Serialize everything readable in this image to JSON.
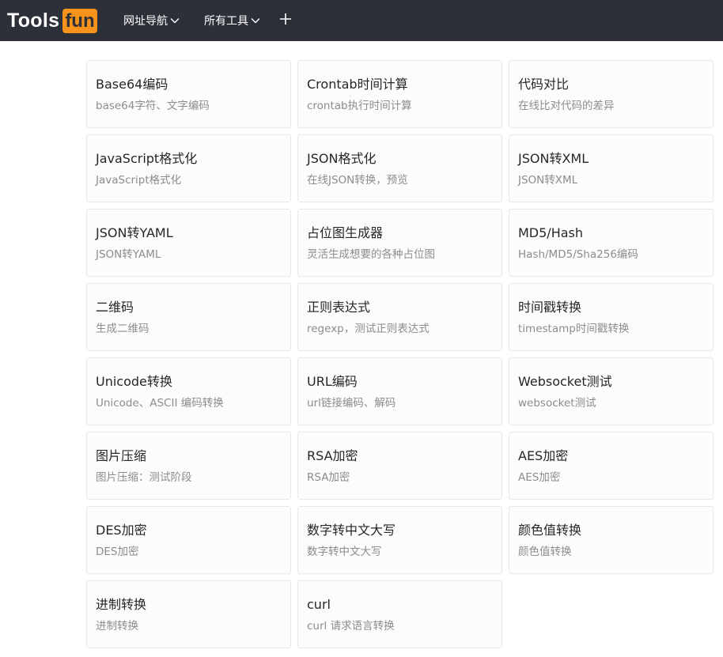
{
  "header": {
    "logo_text": "Tools",
    "logo_badge": "fun",
    "nav": [
      {
        "label": "网址导航",
        "icon": "chevron-down-icon"
      },
      {
        "label": "所有工具",
        "icon": "chevron-down-icon"
      }
    ],
    "add_icon": "plus-icon"
  },
  "tools": [
    {
      "title": "Base64编码",
      "desc": "base64字符、文字编码"
    },
    {
      "title": "Crontab时间计算",
      "desc": "crontab执行时间计算"
    },
    {
      "title": "代码对比",
      "desc": "在线比对代码的差异"
    },
    {
      "title": "JavaScript格式化",
      "desc": "JavaScript格式化"
    },
    {
      "title": "JSON格式化",
      "desc": "在线JSON转换，预览"
    },
    {
      "title": "JSON转XML",
      "desc": "JSON转XML"
    },
    {
      "title": "JSON转YAML",
      "desc": "JSON转YAML"
    },
    {
      "title": "占位图生成器",
      "desc": "灵活生成想要的各种占位图"
    },
    {
      "title": "MD5/Hash",
      "desc": "Hash/MD5/Sha256编码"
    },
    {
      "title": "二维码",
      "desc": "生成二维码"
    },
    {
      "title": "正则表达式",
      "desc": "regexp，测试正则表达式"
    },
    {
      "title": "时间戳转换",
      "desc": "timestamp时间戳转换"
    },
    {
      "title": "Unicode转换",
      "desc": "Unicode、ASCII 编码转换"
    },
    {
      "title": "URL编码",
      "desc": "url链接编码、解码"
    },
    {
      "title": "Websocket测试",
      "desc": "websocket测试"
    },
    {
      "title": "图片压缩",
      "desc": "图片压缩：测试阶段"
    },
    {
      "title": "RSA加密",
      "desc": "RSA加密"
    },
    {
      "title": "AES加密",
      "desc": "AES加密"
    },
    {
      "title": "DES加密",
      "desc": "DES加密"
    },
    {
      "title": "数字转中文大写",
      "desc": "数字转中文大写"
    },
    {
      "title": "颜色值转换",
      "desc": "颜色值转换"
    },
    {
      "title": "进制转换",
      "desc": "进制转换"
    },
    {
      "title": "curl",
      "desc": "curl 请求语言转换"
    }
  ],
  "colors": {
    "header_bg": "#2d3038",
    "logo_badge_bg": "#f7931a",
    "card_border": "#e8e8e8"
  }
}
